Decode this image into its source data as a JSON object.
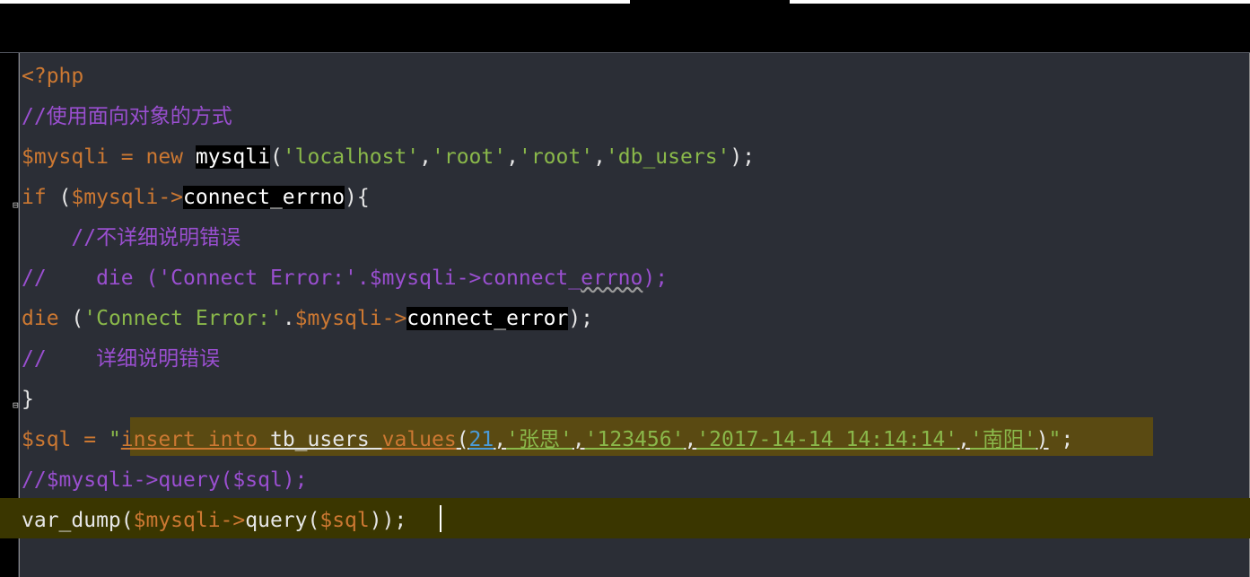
{
  "editor": {
    "lines": [
      {
        "id": "l1",
        "segments": [
          {
            "t": "<?php",
            "c": "ph"
          }
        ]
      },
      {
        "id": "l2",
        "segments": [
          {
            "t": "//使用面向对象的方式",
            "c": "cm"
          }
        ]
      },
      {
        "id": "l3",
        "segments": [
          {
            "t": "$mysqli",
            "c": "var"
          },
          {
            "t": " = ",
            "c": "var"
          },
          {
            "t": "new ",
            "c": "kw"
          },
          {
            "t": "mysqli",
            "c": "hl"
          },
          {
            "t": "(",
            "c": "txt"
          },
          {
            "t": "'localhost'",
            "c": "str"
          },
          {
            "t": ",",
            "c": "txt"
          },
          {
            "t": "'root'",
            "c": "str"
          },
          {
            "t": ",",
            "c": "txt"
          },
          {
            "t": "'root'",
            "c": "str"
          },
          {
            "t": ",",
            "c": "txt"
          },
          {
            "t": "'db_users'",
            "c": "str"
          },
          {
            "t": ");",
            "c": "txt"
          }
        ]
      },
      {
        "id": "l4",
        "segments": [
          {
            "t": "if ",
            "c": "kw"
          },
          {
            "t": "(",
            "c": "txt"
          },
          {
            "t": "$mysqli->",
            "c": "var"
          },
          {
            "t": "connect_errno",
            "c": "hl"
          },
          {
            "t": "){",
            "c": "txt"
          }
        ]
      },
      {
        "id": "l5",
        "segments": [
          {
            "t": "    //不详细说明错误",
            "c": "cm"
          }
        ]
      },
      {
        "id": "l6",
        "segments": [
          {
            "t": "//    die ('Connect Error:'.$mysqli->connect_",
            "c": "cm"
          },
          {
            "t": "errno",
            "c": "cmsq"
          },
          {
            "t": ");",
            "c": "cm"
          }
        ]
      },
      {
        "id": "l7",
        "segments": [
          {
            "t": "die ",
            "c": "kw"
          },
          {
            "t": "(",
            "c": "txt"
          },
          {
            "t": "'Connect Error:'",
            "c": "str"
          },
          {
            "t": ".",
            "c": "txt"
          },
          {
            "t": "$mysqli->",
            "c": "var"
          },
          {
            "t": "connect_error",
            "c": "hl"
          },
          {
            "t": ");",
            "c": "txt"
          }
        ]
      },
      {
        "id": "l8",
        "segments": [
          {
            "t": "//    详细说明错误",
            "c": "cm"
          }
        ]
      },
      {
        "id": "l9",
        "segments": [
          {
            "t": "}",
            "c": "txt"
          }
        ]
      },
      {
        "id": "l10",
        "segments": [
          {
            "t": "$sql",
            "c": "var"
          },
          {
            "t": " = ",
            "c": "var"
          },
          {
            "t": "\"",
            "c": "str"
          },
          {
            "t": "insert into ",
            "c": "kwul"
          },
          {
            "t": "tb_users ",
            "c": "txtul"
          },
          {
            "t": "values",
            "c": "kwul"
          },
          {
            "t": "(",
            "c": "txtul"
          },
          {
            "t": "21",
            "c": "numul"
          },
          {
            "t": ",",
            "c": "txtul"
          },
          {
            "t": "'张思'",
            "c": "strul"
          },
          {
            "t": ",",
            "c": "txtul"
          },
          {
            "t": "'123456'",
            "c": "strul"
          },
          {
            "t": ",",
            "c": "txtul"
          },
          {
            "t": "'2017-14-14 14:14:14'",
            "c": "strul"
          },
          {
            "t": ",",
            "c": "txtul"
          },
          {
            "t": "'南阳'",
            "c": "strul"
          },
          {
            "t": ")",
            "c": "txtul"
          },
          {
            "t": "\"",
            "c": "str"
          },
          {
            "t": ";",
            "c": "txt"
          }
        ]
      },
      {
        "id": "l11",
        "segments": [
          {
            "t": "//$mysqli->query($sql);",
            "c": "cm"
          }
        ]
      },
      {
        "id": "l12",
        "segments": [
          {
            "t": "var_dump(",
            "c": "txt"
          },
          {
            "t": "$mysqli->",
            "c": "var"
          },
          {
            "t": "query(",
            "c": "txt"
          },
          {
            "t": "$sql",
            "c": "var"
          },
          {
            "t": "));",
            "c": "txt"
          }
        ]
      }
    ]
  }
}
